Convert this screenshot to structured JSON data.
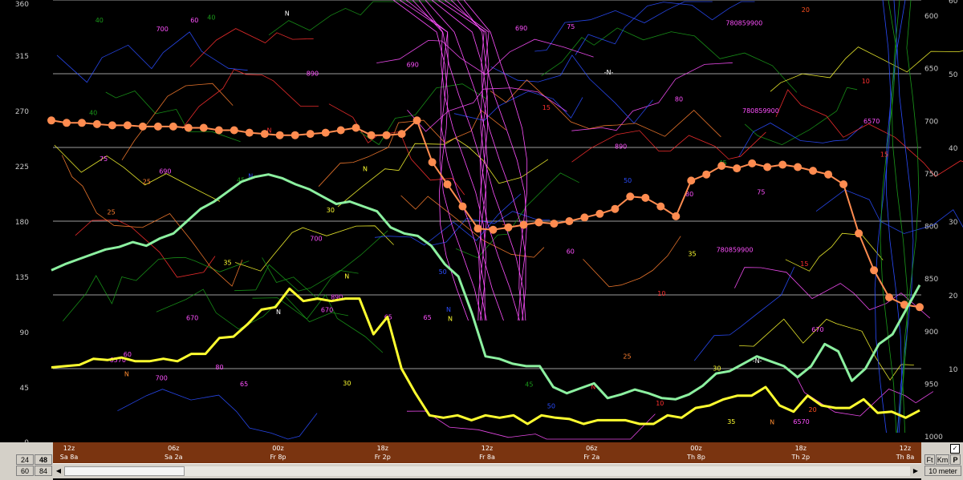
{
  "colors": {
    "background": "#000000",
    "grid": "#cfcfcf",
    "orange_series": "#ff8c50",
    "green_series": "#8cf0a0",
    "yellow_series": "#ffff30",
    "timebar": "#7a3410",
    "panel": "#d4d0c8"
  },
  "chart_data": {
    "type": "line",
    "left_axis": {
      "range": [
        0,
        360
      ],
      "ticks": [
        "0",
        "45",
        "90",
        "135",
        "180",
        "225",
        "270",
        "315",
        "360"
      ]
    },
    "right_axis_outer": {
      "range": [
        0,
        60
      ],
      "ticks": [
        "10",
        "20",
        "30",
        "40",
        "50",
        "60"
      ]
    },
    "right_axis_inner": {
      "ticks": [
        "600",
        "650",
        "700",
        "750",
        "800",
        "850",
        "900",
        "950",
        "1000"
      ]
    },
    "x_categories": [
      {
        "top": "12z",
        "bottom": "Sa 8a"
      },
      {
        "top": "06z",
        "bottom": "Sa 2a"
      },
      {
        "top": "00z",
        "bottom": "Fr 8p"
      },
      {
        "top": "18z",
        "bottom": "Fr 2p"
      },
      {
        "top": "12z",
        "bottom": "Fr 8a"
      },
      {
        "top": "06z",
        "bottom": "Fr 2a"
      },
      {
        "top": "00z",
        "bottom": "Th 8p"
      },
      {
        "top": "18z",
        "bottom": "Th 2p"
      },
      {
        "top": "12z",
        "bottom": "Th 8a"
      }
    ],
    "series": [
      {
        "color": "#ff8c50",
        "values": [
          262,
          260,
          260,
          259,
          258,
          258,
          257,
          257,
          257,
          256,
          256,
          254,
          254,
          252,
          251,
          250,
          250,
          251,
          252,
          254,
          256,
          250,
          250,
          251,
          262,
          228,
          210,
          192,
          174,
          173,
          175,
          177,
          179,
          178,
          180,
          183,
          186,
          190,
          200,
          199,
          192,
          184,
          213,
          218,
          225,
          223,
          227,
          224,
          226,
          224,
          221,
          218,
          210,
          170,
          140,
          118,
          112,
          110
        ]
      },
      {
        "color": "#8cf0a0",
        "values": [
          140,
          145,
          149,
          153,
          157,
          159,
          163,
          160,
          166,
          170,
          180,
          190,
          196,
          204,
          212,
          216,
          218,
          215,
          210,
          206,
          200,
          194,
          196,
          192,
          188,
          175,
          170,
          168,
          160,
          145,
          135,
          105,
          70,
          68,
          64,
          62,
          62,
          45,
          40,
          44,
          48,
          36,
          39,
          43,
          40,
          36,
          35,
          39,
          46,
          56,
          58,
          64,
          70,
          66,
          62,
          53,
          62,
          80,
          74,
          50,
          60,
          80,
          88,
          108,
          128
        ]
      },
      {
        "color": "#ffff30",
        "values": [
          61,
          62,
          63,
          68,
          67,
          69,
          66,
          66,
          68,
          66,
          72,
          72,
          85,
          86,
          96,
          108,
          110,
          125,
          115,
          117,
          115,
          117,
          117,
          88,
          102,
          60,
          40,
          22,
          20,
          22,
          18,
          22,
          20,
          22,
          15,
          22,
          20,
          19,
          15,
          18,
          18,
          18,
          15,
          15,
          22,
          20,
          28,
          30,
          35,
          38,
          38,
          45,
          30,
          25,
          38,
          30,
          28,
          28,
          35,
          24,
          25,
          20,
          26
        ]
      }
    ],
    "contour_labels": [
      {
        "t": "50",
        "c": "#2a4cff"
      },
      {
        "t": "45",
        "c": "#1a9a1a"
      },
      {
        "t": "60",
        "c": "#ff50ff"
      },
      {
        "t": "780859900",
        "c": "#ff50ff"
      },
      {
        "t": "6570",
        "c": "#ff50ff"
      },
      {
        "t": "890",
        "c": "#ff50ff"
      },
      {
        "t": "65",
        "c": "#ff50ff"
      },
      {
        "t": "700",
        "c": "#ff50ff"
      },
      {
        "t": "670",
        "c": "#ff50ff"
      },
      {
        "t": "80",
        "c": "#ff50ff"
      },
      {
        "t": "75",
        "c": "#ff50ff"
      },
      {
        "t": "690",
        "c": "#ff50ff"
      },
      {
        "t": "40",
        "c": "#1a9a1a"
      },
      {
        "t": "35",
        "c": "#ffff30"
      },
      {
        "t": "30",
        "c": "#ffff30"
      },
      {
        "t": "25",
        "c": "#ff8030"
      },
      {
        "t": "20",
        "c": "#ff5020"
      },
      {
        "t": "15",
        "c": "#ff3030"
      },
      {
        "t": "10",
        "c": "#ff3030"
      },
      {
        "t": "N",
        "c": "#ffff30"
      },
      {
        "t": "N",
        "c": "#ff8c30"
      },
      {
        "t": "N",
        "c": "#2a4cff"
      },
      {
        "t": "N",
        "c": "#ff3030"
      },
      {
        "t": "N",
        "c": "#ffffff"
      },
      {
        "t": "-N-",
        "c": "#ffffff"
      }
    ]
  },
  "left_panel": {
    "btn1": "24",
    "btn2": "48",
    "btn3": "60",
    "btn4": "84"
  },
  "right_panel": {
    "ft": "Ft",
    "km": "Km",
    "p": "P",
    "height": "10 meter"
  }
}
